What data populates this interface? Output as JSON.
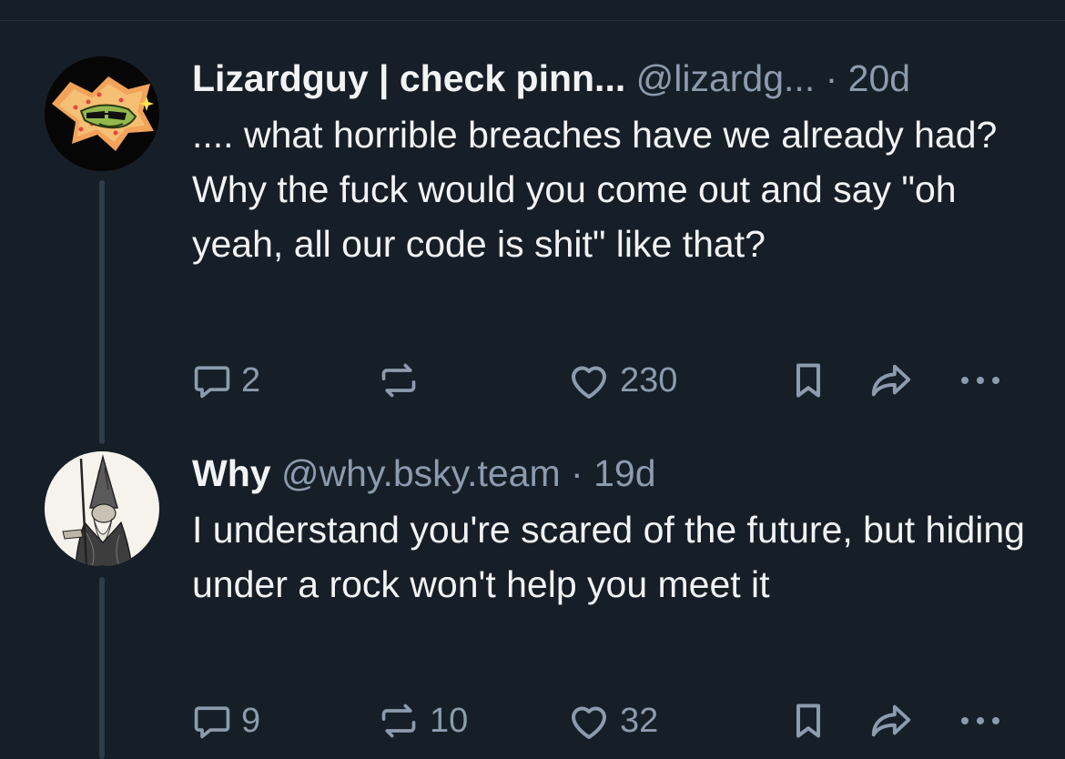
{
  "posts": [
    {
      "display_name": "Lizardguy | check pinn...",
      "handle": "@lizardg...",
      "time": "· 20d",
      "text": ".... what horrible breaches have we already had? Why the fuck would you come out and say \"oh yeah, all our code is shit\" like that?",
      "reply_count": "2",
      "repost_count": "",
      "like_count": "230"
    },
    {
      "display_name": "Why",
      "handle": "@why.bsky.team",
      "time": "· 19d",
      "text": "I understand you're scared of the future, but hiding under a rock won't help you meet it",
      "reply_count": "9",
      "repost_count": "10",
      "like_count": "32"
    }
  ],
  "colors": {
    "background": "#161e27",
    "text": "#f1f3f5",
    "muted": "#8c9bad",
    "thread_line": "#2e3c4b"
  },
  "icons": [
    "reply-icon",
    "repost-icon",
    "like-icon",
    "bookmark-icon",
    "share-icon",
    "more-icon"
  ]
}
